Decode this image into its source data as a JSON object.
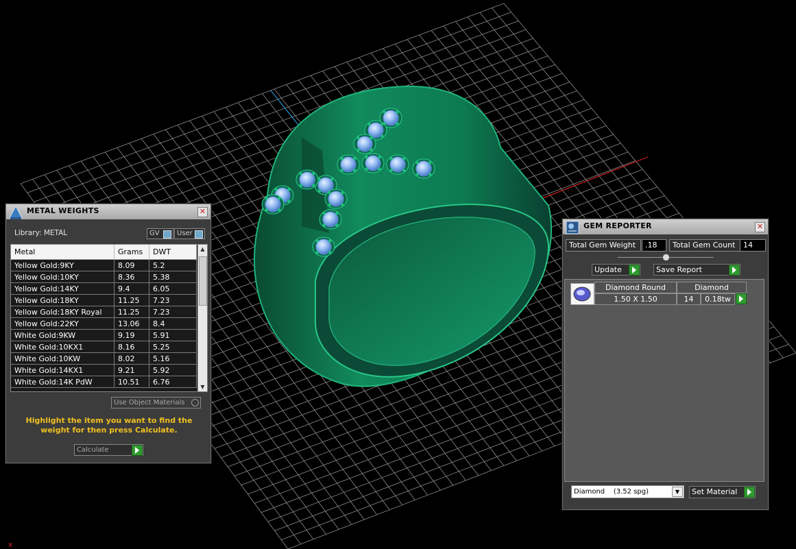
{
  "viewport": {
    "axis_marker": "x"
  },
  "metal_weights": {
    "title": "METAL WEIGHTS",
    "library_label": "Library: METAL",
    "toggle_gv": "GV",
    "toggle_user": "User",
    "columns": [
      "Metal",
      "Grams",
      "DWT"
    ],
    "rows": [
      [
        "Yellow Gold:9KY",
        "8.09",
        "5.2"
      ],
      [
        "Yellow Gold:10KY",
        "8.36",
        "5.38"
      ],
      [
        "Yellow Gold:14KY",
        "9.4",
        "6.05"
      ],
      [
        "Yellow Gold:18KY",
        "11.25",
        "7.23"
      ],
      [
        "Yellow Gold:18KY Royal",
        "11.25",
        "7.23"
      ],
      [
        "Yellow Gold:22KY",
        "13.06",
        "8.4"
      ],
      [
        "White Gold:9KW",
        "9.19",
        "5.91"
      ],
      [
        "White Gold:10KX1",
        "8.16",
        "5.25"
      ],
      [
        "White Gold:10KW",
        "8.02",
        "5.16"
      ],
      [
        "White Gold:14KX1",
        "9.21",
        "5.92"
      ],
      [
        "White Gold:14K PdW",
        "10.51",
        "6.76"
      ]
    ],
    "use_object_materials": "Use Object Materials",
    "hint": "Highlight the item you want to find the weight for then press Calculate.",
    "calculate_label": "Calculate"
  },
  "gem_reporter": {
    "title": "GEM REPORTER",
    "total_weight_label": "Total Gem Weight",
    "total_weight_value": ".18",
    "total_count_label": "Total Gem Count",
    "total_count_value": "14",
    "update_label": "Update",
    "save_report_label": "Save Report",
    "gems": [
      {
        "shape": "Diamond Round",
        "material": "Diamond",
        "size": "1.50 X 1.50",
        "count": "14",
        "weight": "0.18tw"
      }
    ],
    "material_select": "Diamond    (3.52 spg)",
    "set_material_label": "Set Material"
  },
  "colors": {
    "ring": "#0f6b4a",
    "gem": "#8fb8f0",
    "grid": "#cfcfcf",
    "hint": "#f0c020",
    "button_green": "#2f9b2f"
  }
}
